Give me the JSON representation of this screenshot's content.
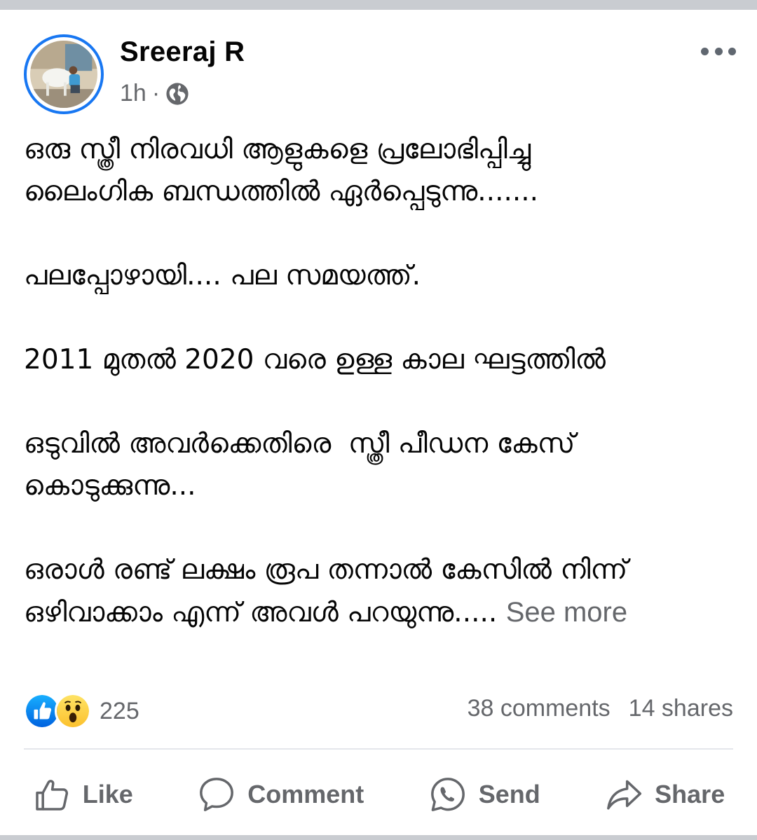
{
  "post": {
    "author": "Sreeraj R",
    "time": "1h",
    "separator": "·",
    "privacy_icon": "globe-icon",
    "paragraphs": [
      "ഒരു സ്ത്രീ നിരവധി ആളുകളെ പ്രലോഭിപ്പിച്ചു\nലൈംഗിക ബന്ധത്തിൽ ഏർപ്പെടുന്നു.......",
      "പലപ്പോഴായി.... പല സമയത്ത്.",
      "2011 മുതൽ 2020 വരെ ഉള്ള കാല ഘട്ടത്തിൽ",
      "ഒടുവിൽ അവർക്കെതിരെ  സ്ത്രീ പീഡന കേസ്\nകൊടുക്കുന്നു...",
      "ഒരാൾ രണ്ട് ലക്ഷം രൂപ തന്നാൽ കേസിൽ നിന്ന്\nഒഴിവാക്കാം എന്ന് അവൾ പറയുന്നു..... "
    ],
    "see_more": "See more"
  },
  "reactions": {
    "count": "225",
    "icons": [
      "like-reaction-icon",
      "wow-reaction-icon"
    ],
    "comments": "38 comments",
    "shares": "14 shares"
  },
  "actions": {
    "like": "Like",
    "comment": "Comment",
    "send": "Send",
    "share": "Share"
  },
  "colors": {
    "accent": "#1877f2",
    "text": "#050505",
    "secondary": "#65676b",
    "background": "#c9ccd1"
  }
}
